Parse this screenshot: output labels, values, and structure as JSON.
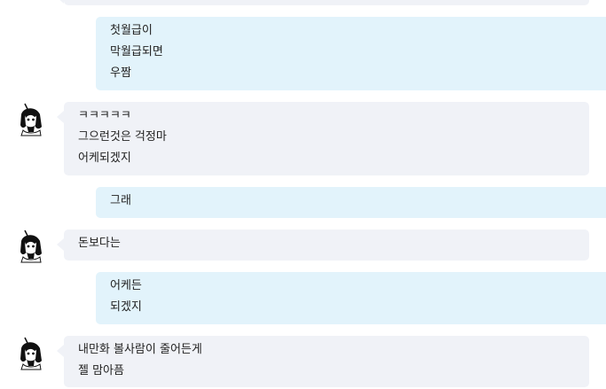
{
  "messages": [
    {
      "sender": "me",
      "lines": [
        "",
        "",
        ""
      ]
    },
    {
      "sender": "me",
      "lines": [
        "첫월급이",
        "막월급되면",
        "우짬"
      ]
    },
    {
      "sender": "other",
      "avatar_icon": "anime-girl-avatar-icon",
      "lines": [
        "ㅋㅋㅋㅋㅋ",
        "그으런것은 걱정마",
        "어케되겠지"
      ]
    },
    {
      "sender": "me",
      "lines": [
        "그래"
      ]
    },
    {
      "sender": "other",
      "avatar_icon": "anime-girl-avatar-icon",
      "lines": [
        "돈보다는"
      ]
    },
    {
      "sender": "me",
      "lines": [
        "어케든",
        "되겠지"
      ]
    },
    {
      "sender": "other",
      "avatar_icon": "anime-girl-avatar-icon",
      "lines": [
        "내만화 볼사람이 줄어든게",
        "젤 맘아픔"
      ]
    }
  ],
  "colors": {
    "my_bubble": "#e2f3fb",
    "other_bubble": "#f0f2f7",
    "text": "#222222"
  }
}
